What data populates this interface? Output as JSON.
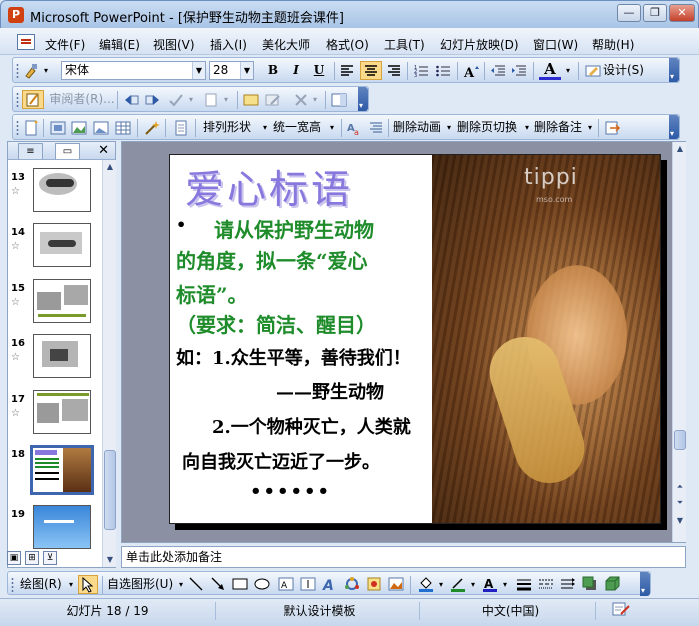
{
  "window": {
    "app_icon": "P",
    "title": "Microsoft PowerPoint - [保护野生动物主题班会课件]",
    "minimize": "—",
    "restore": "❐",
    "close": "✕"
  },
  "menu": {
    "items": [
      "文件(F)",
      "编辑(E)",
      "视图(V)",
      "插入(I)",
      "美化大师",
      "格式(O)",
      "工具(T)",
      "幻灯片放映(D)",
      "窗口(W)",
      "帮助(H)"
    ]
  },
  "format_toolbar": {
    "font_name": "宋体",
    "font_size": "28",
    "bold": "B",
    "italic": "I",
    "underline": "U",
    "font_color_label": "A",
    "design_label": "设计(S)"
  },
  "review_toolbar": {
    "reviewer_label": "审阅者(R)..."
  },
  "extra_toolbar": {
    "arrange_label": "排列形状",
    "unify_width_label": "统一宽高",
    "delete_animation_label": "删除动画",
    "delete_transition_label": "删除页切换",
    "delete_notes_label": "删除备注"
  },
  "slides_panel": {
    "tab_outline_icon": "≡",
    "tab_slides_icon": "▭",
    "close": "✕",
    "thumbnails": [
      {
        "number": "13",
        "star": "☆",
        "bg": "#d8d8d8"
      },
      {
        "number": "14",
        "star": "☆",
        "bg": "#cfcfcf"
      },
      {
        "number": "15",
        "star": "☆",
        "bg": "#e0e0e0"
      },
      {
        "number": "16",
        "star": "☆",
        "bg": "#d5d5d5"
      },
      {
        "number": "17",
        "star": "☆",
        "bg": "#dadada"
      },
      {
        "number": "18",
        "star": "",
        "bg": "#fff"
      },
      {
        "number": "19",
        "star": "",
        "bg": "#3a86d9"
      }
    ]
  },
  "slide": {
    "title": "爱心标语",
    "bullet": "•",
    "line1": "请从保护野生动物",
    "line2": "的角度，拟一条“爱心",
    "line3": "标语”。",
    "line4": "（要求：简洁、醒目）",
    "line5": "如：1.众生平等，善待我们！",
    "line6": "——野生动物",
    "line7": "2.一个物种灭亡，人类就",
    "line8": "向自我灭亡迈近了一步。",
    "line9": "••••••",
    "watermark": "tippi",
    "watermark_sub": "mso.com"
  },
  "notes": {
    "placeholder": "单击此处添加备注"
  },
  "drawing_toolbar": {
    "draw_label": "绘图(R)",
    "autoshapes_label": "自选图形(U)"
  },
  "statusbar": {
    "slide_info": "幻灯片 18 / 19",
    "design_template": "默认设计模板",
    "language": "中文(中国)"
  }
}
